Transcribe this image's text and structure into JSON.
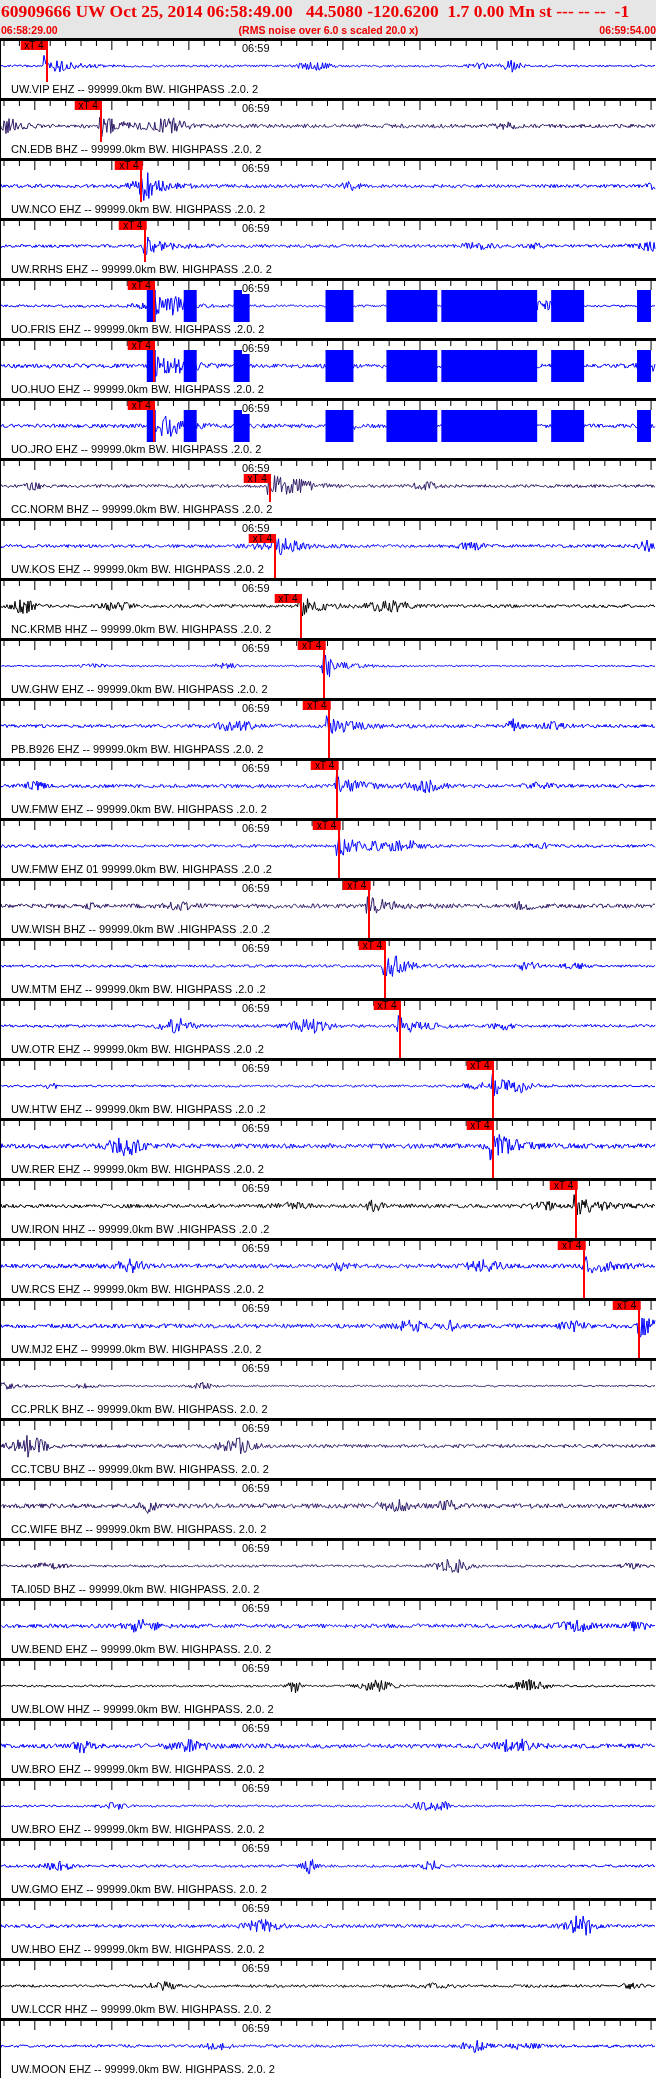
{
  "header": {
    "title": "60909666 UW Oct 25, 2014 06:58:49.00   44.5080 -120.6200  1.7 0.00 Mn st --- -- --  -1",
    "start_time": "06:58:29.00",
    "note": "(RMS noise over 6.0 s scaled 20.0 x)",
    "end_time": "06:59:54.00"
  },
  "traces": [
    {
      "label": "UW.VIP EHZ -- 99999.0km BW. HIGHPASS .2.0. 2",
      "color": "#0000ff",
      "kind": "normal",
      "time_label": "06:59",
      "pick": {
        "label": "xT 4",
        "level": 0.071
      }
    },
    {
      "label": "CN.EDB BHZ -- 99999.0km BW. HIGHPASS .2.0. 2",
      "color": "#2e1a66",
      "kind": "normal",
      "time_label": "06:59",
      "pick": {
        "label": "xT 4",
        "level": 0.154
      }
    },
    {
      "label": "UW.NCO EHZ -- 99999.0km BW. HIGHPASS .2.0. 2",
      "color": "#0000ff",
      "kind": "normal",
      "time_label": "06:59",
      "pick": {
        "label": "xT 4",
        "level": 0.216
      }
    },
    {
      "label": "UW.RRHS EHZ -- 99999.0km BW. HIGHPASS .2.0. 2",
      "color": "#0000ff",
      "kind": "normal",
      "time_label": "06:59",
      "pick": {
        "label": "xT 4",
        "level": 0.222
      }
    },
    {
      "label": "UO.FRIS EHZ -- 99999.0km BW. HIGHPASS .2.0. 2",
      "color": "#0000ff",
      "kind": "clipped",
      "time_label": "06:59",
      "pick": {
        "label": "xT 4",
        "level": 0.235
      }
    },
    {
      "label": "UO.HUO EHZ -- 99999.0km BW. HIGHPASS .2.0. 2",
      "color": "#0000ff",
      "kind": "clipped",
      "time_label": "06:59",
      "pick": {
        "label": "xT 4",
        "level": 0.235
      }
    },
    {
      "label": "UO.JRO EHZ -- 99999.0km BW. HIGHPASS .2.0. 2",
      "color": "#0000ff",
      "kind": "clipped",
      "time_label": "06:59",
      "pick": {
        "label": "xT 4",
        "level": 0.235
      }
    },
    {
      "label": "CC.NORM BHZ -- 99999.0km BW. HIGHPASS .2.0. 2",
      "color": "#2e1a66",
      "kind": "normal",
      "time_label": "06:59",
      "pick": {
        "label": "xT 4",
        "level": 0.412
      }
    },
    {
      "label": "UW.KOS EHZ -- 99999.0km BW. HIGHPASS .2.0. 2",
      "color": "#0000ff",
      "kind": "normal",
      "time_label": "06:59",
      "pick": {
        "label": "xT 4",
        "level": 0.42
      }
    },
    {
      "label": "NC.KRMB HHZ -- 99999.0km BW. HIGHPASS .2.0. 2",
      "color": "#000000",
      "kind": "normal",
      "time_label": "06:59",
      "pick": {
        "label": "xT 4",
        "level": 0.459
      }
    },
    {
      "label": "UW.GHW EHZ -- 99999.0km BW. HIGHPASS .2.0. 2",
      "color": "#0000ff",
      "kind": "normal",
      "time_label": "06:59",
      "pick": {
        "label": "xT 4",
        "level": 0.495
      }
    },
    {
      "label": "PB.B926 EHZ -- 99999.0km BW. HIGHPASS .2.0. 2",
      "color": "#0000ff",
      "kind": "normal",
      "time_label": "06:59",
      "pick": {
        "label": "xT 4",
        "level": 0.503
      }
    },
    {
      "label": "UW.FMW EHZ -- 99999.0km BW. HIGHPASS .2.0. 2",
      "color": "#0000ff",
      "kind": "normal",
      "time_label": "06:59",
      "pick": {
        "label": "xT 4",
        "level": 0.515
      }
    },
    {
      "label": "UW.FMW EHZ 01 99999.0km BW. HIGHPASS .2.0 .2",
      "color": "#0000ff",
      "kind": "normal",
      "time_label": "06:59",
      "pick": {
        "label": "xT 4",
        "level": 0.518
      }
    },
    {
      "label": "UW.WISH BHZ -- 99999.0km BW .HIGHPASS .2.0 .2",
      "color": "#2e1a66",
      "kind": "normal",
      "time_label": "06:59",
      "pick": {
        "label": "xT 4",
        "level": 0.564
      }
    },
    {
      "label": "UW.MTM EHZ -- 99999.0km BW. HIGHPASS .2.0 .2",
      "color": "#0000ff",
      "kind": "normal",
      "time_label": "06:59",
      "pick": {
        "label": "xT 4",
        "level": 0.588
      }
    },
    {
      "label": "UW.OTR EHZ -- 99999.0km BW. HIGHPASS .2.0 .2",
      "color": "#0000ff",
      "kind": "normal",
      "time_label": "06:59",
      "pick": {
        "label": "xT 4",
        "level": 0.61
      }
    },
    {
      "label": "UW.HTW EHZ -- 99999.0km BW. HIGHPASS .2.0 .2",
      "color": "#0000ff",
      "kind": "normal",
      "time_label": "06:59",
      "pick": {
        "label": "xT 4",
        "level": 0.752
      }
    },
    {
      "label": "UW.RER EHZ -- 99999.0km BW. HIGHPASS .2.0. 2",
      "color": "#0000ff",
      "kind": "normal",
      "time_label": "06:59",
      "pick": {
        "label": "xT 4",
        "level": 0.752
      }
    },
    {
      "label": "UW.IRON HHZ -- 99999.0km BW .HIGHPASS .2.0 .2",
      "color": "#000000",
      "kind": "normal",
      "time_label": "06:59",
      "pick": {
        "label": "xT 4",
        "level": 0.88
      }
    },
    {
      "label": "UW.RCS EHZ -- 99999.0km BW. HIGHPASS .2.0. 2",
      "color": "#0000ff",
      "kind": "normal",
      "time_label": "06:59",
      "pick": {
        "label": "xT 4",
        "level": 0.892
      }
    },
    {
      "label": "UW.MJ2 EHZ -- 99999.0km BW. HIGHPASS .2.0. 2",
      "color": "#0000ff",
      "kind": "normal",
      "time_label": "06:59",
      "pick": {
        "label": "xT 4",
        "level": 0.976
      }
    },
    {
      "label": "CC.PRLK BHZ -- 99999.0km BW. HIGHPASS. 2.0. 2",
      "color": "#2e1a66",
      "kind": "normal",
      "time_label": "06:59"
    },
    {
      "label": "CC.TCBU BHZ -- 99999.0km BW. HIGHPASS. 2.0. 2",
      "color": "#2e1a66",
      "kind": "normal",
      "time_label": "06:59"
    },
    {
      "label": "CC.WIFE BHZ -- 99999.0km BW. HIGHPASS. 2.0. 2",
      "color": "#2e1a66",
      "kind": "normal",
      "time_label": "06:59"
    },
    {
      "label": "TA.I05D BHZ -- 99999.0km BW. HIGHPASS. 2.0. 2",
      "color": "#2e1a66",
      "kind": "normal",
      "time_label": "06:59"
    },
    {
      "label": "UW.BEND EHZ -- 99999.0km BW. HIGHPASS. 2.0. 2",
      "color": "#0000ff",
      "kind": "normal",
      "time_label": "06:59"
    },
    {
      "label": "UW.BLOW HHZ -- 99999.0km BW. HIGHPASS. 2.0. 2",
      "color": "#000000",
      "kind": "normal",
      "time_label": "06:59"
    },
    {
      "label": "UW.BRO EHZ -- 99999.0km BW. HIGHPASS. 2.0. 2",
      "color": "#0000ff",
      "kind": "normal",
      "time_label": "06:59"
    },
    {
      "label": "UW.BRO EHZ -- 99999.0km BW. HIGHPASS. 2.0. 2",
      "color": "#0000ff",
      "kind": "normal",
      "time_label": "06:59"
    },
    {
      "label": "UW.GMO EHZ -- 99999.0km BW. HIGHPASS. 2.0. 2",
      "color": "#0000ff",
      "kind": "normal",
      "time_label": "06:59"
    },
    {
      "label": "UW.HBO EHZ -- 99999.0km BW. HIGHPASS. 2.0. 2",
      "color": "#0000ff",
      "kind": "normal",
      "time_label": "06:59"
    },
    {
      "label": "UW.LCCR HHZ -- 99999.0km BW. HIGHPASS. 2.0. 2",
      "color": "#000000",
      "kind": "normal",
      "time_label": "06:59"
    },
    {
      "label": "UW.MOON EHZ -- 99999.0km BW. HIGHPASS. 2.0. 2",
      "color": "#0000ff",
      "kind": "normal",
      "time_label": "06:59"
    }
  ]
}
